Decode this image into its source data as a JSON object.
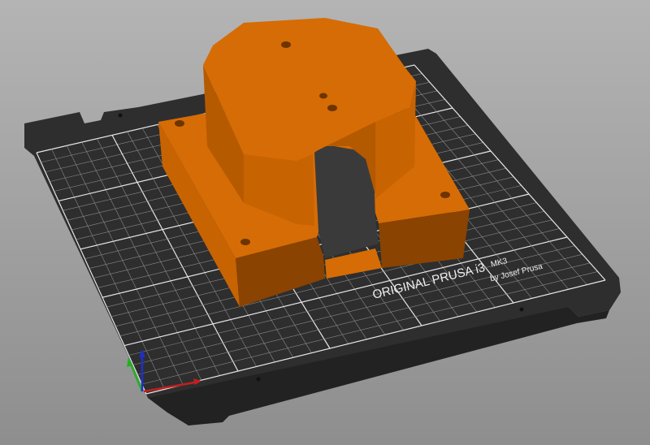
{
  "viewport": {
    "bed_logo": {
      "line1": "ORIGINAL PRUSA i3",
      "model": "MK3",
      "line2": "by Josef Prusa"
    },
    "colors": {
      "background_top": "#b4b4b4",
      "background_bottom": "#8e8e8e",
      "bed": "#2f2f2f",
      "grid": "#d8d8d8",
      "object_top": "#d66c05",
      "object_side_light": "#c86302",
      "object_side_dark": "#8a4300",
      "axis_x": "#c0201f",
      "axis_y": "#22b022",
      "axis_z": "#1d2fc9"
    }
  }
}
